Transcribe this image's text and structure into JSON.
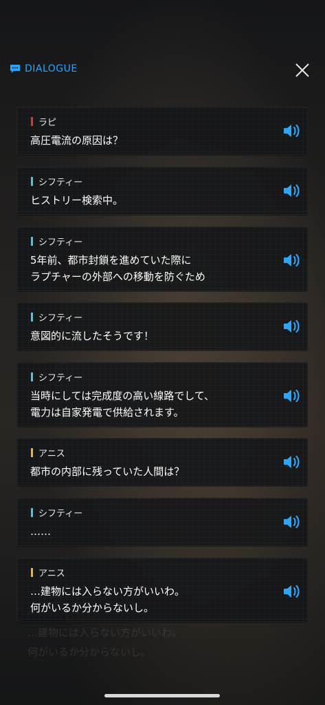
{
  "header": {
    "title": "DIALOGUE",
    "icon": "chat-bubble-icon",
    "close_icon": "close-icon",
    "accent": "#2aa6ff"
  },
  "colors": {
    "rapi": "#d63a2a",
    "siphty": "#4ec3e6",
    "anis": "#f2b233",
    "voice_icon": "#2aa6ff"
  },
  "messages": [
    {
      "speaker": "ラピ",
      "text": "高圧電流の原因は？",
      "color_key": "rapi"
    },
    {
      "speaker": "シフティー",
      "text": "ヒストリー検索中。",
      "color_key": "siphty"
    },
    {
      "speaker": "シフティー",
      "text": "5年前、都市封鎖を進めていた際に\nラプチャーの外部への移動を防ぐため",
      "color_key": "siphty"
    },
    {
      "speaker": "シフティー",
      "text": "意図的に流したそうです！",
      "color_key": "siphty"
    },
    {
      "speaker": "シフティー",
      "text": "当時にしては完成度の高い線路でして、\n電力は自家発電で供給されます。",
      "color_key": "siphty"
    },
    {
      "speaker": "アニス",
      "text": "都市の内部に残っていた人間は？",
      "color_key": "anis"
    },
    {
      "speaker": "シフティー",
      "text": "……",
      "color_key": "siphty"
    },
    {
      "speaker": "アニス",
      "text": "…建物には入らない方がいいわ。\n何がいるか分からないし。",
      "color_key": "anis"
    }
  ],
  "background_ghost_text": "…建物には入らない方がいいわ。\n何がいるか分からないし。"
}
